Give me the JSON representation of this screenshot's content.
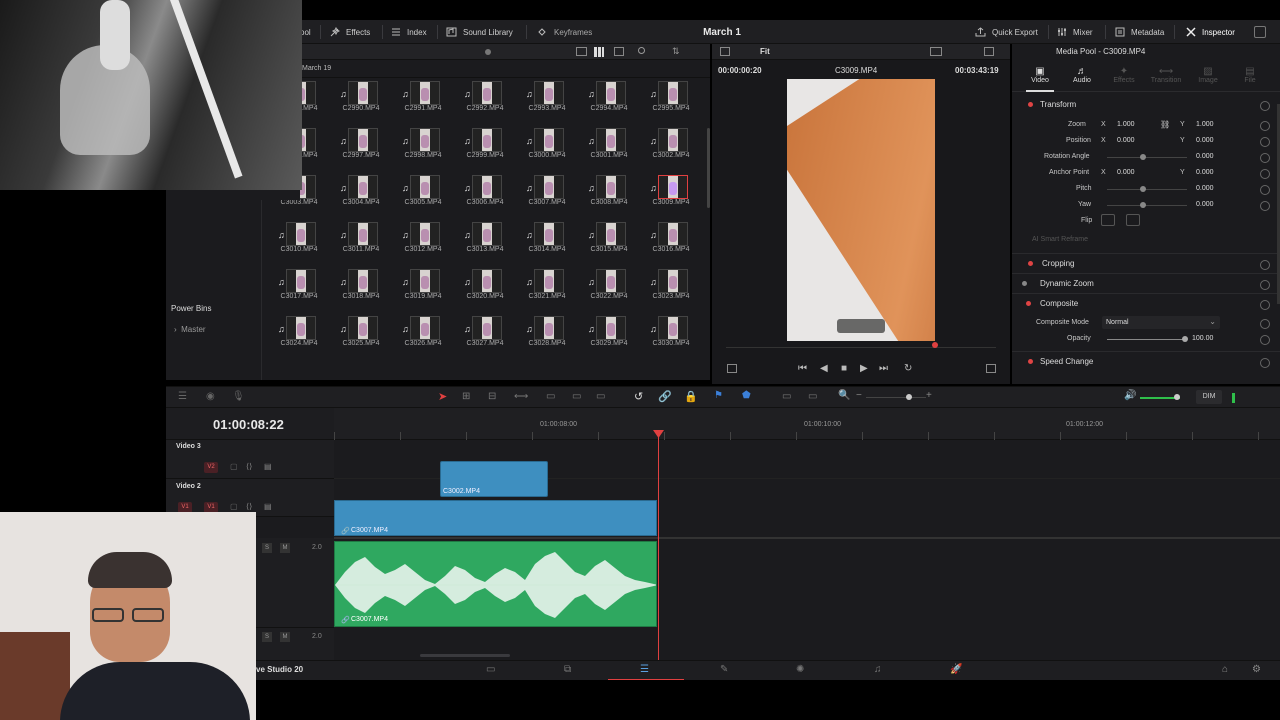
{
  "topbar": {
    "media_pool_partial": "ool",
    "effects": "Effects",
    "index": "Index",
    "sound_library": "Sound Library",
    "keyframes": "Keyframes",
    "title": "March 1",
    "quick_export": "Quick Export",
    "mixer": "Mixer",
    "metadata": "Metadata",
    "inspector": "Inspector"
  },
  "media_pool": {
    "folder": "March 19",
    "fit": "Fit",
    "power_bins": "Power Bins",
    "master": "Master",
    "rows": [
      [
        "C2989.MP4",
        "C2990.MP4",
        "C2991.MP4",
        "C2992.MP4",
        "C2993.MP4",
        "C2994.MP4",
        "C2995.MP4"
      ],
      [
        "C2996.MP4",
        "C2997.MP4",
        "C2998.MP4",
        "C2999.MP4",
        "C3000.MP4",
        "C3001.MP4",
        "C3002.MP4"
      ],
      [
        "C3003.MP4",
        "C3004.MP4",
        "C3005.MP4",
        "C3006.MP4",
        "C3007.MP4",
        "C3008.MP4",
        "C3009.MP4"
      ],
      [
        "C3010.MP4",
        "C3011.MP4",
        "C3012.MP4",
        "C3013.MP4",
        "C3014.MP4",
        "C3015.MP4",
        "C3016.MP4"
      ],
      [
        "C3017.MP4",
        "C3018.MP4",
        "C3019.MP4",
        "C3020.MP4",
        "C3021.MP4",
        "C3022.MP4",
        "C3023.MP4"
      ],
      [
        "C3024.MP4",
        "C3025.MP4",
        "C3026.MP4",
        "C3027.MP4",
        "C3028.MP4",
        "C3029.MP4",
        "C3030.MP4"
      ]
    ],
    "selected": "C3009.MP4"
  },
  "viewer": {
    "timecode_left": "00:00:00:20",
    "clip_name": "C3009.MP4",
    "timecode_right": "00:03:43:19"
  },
  "inspector": {
    "title": "Media Pool - C3009.MP4",
    "tabs": [
      "Video",
      "Audio",
      "Effects",
      "Transition",
      "Image",
      "File"
    ],
    "transform": "Transform",
    "zoom_label": "Zoom",
    "zoom_x": "1.000",
    "zoom_y": "1.000",
    "position_label": "Position",
    "position_x": "0.000",
    "position_y": "0.000",
    "rotation_label": "Rotation Angle",
    "rotation": "0.000",
    "anchor_label": "Anchor Point",
    "anchor_x": "0.000",
    "anchor_y": "0.000",
    "pitch_label": "Pitch",
    "pitch": "0.000",
    "yaw_label": "Yaw",
    "yaw": "0.000",
    "flip_label": "Flip",
    "smart_reframe": "AI Smart Reframe",
    "cropping": "Cropping",
    "dynamic_zoom": "Dynamic Zoom",
    "composite": "Composite",
    "composite_mode_label": "Composite Mode",
    "composite_mode": "Normal",
    "opacity_label": "Opacity",
    "opacity": "100.00",
    "speed_change": "Speed Change",
    "x": "X",
    "y": "Y"
  },
  "timeline": {
    "timecode": "01:00:08:22",
    "ruler": [
      "01:00:08:00",
      "01:00:10:00",
      "01:00:12:00"
    ],
    "video3": "Video 3",
    "video2": "Video 2",
    "v2": "V2",
    "v1a": "V1",
    "v1b": "V1",
    "clip_v2": "C3002.MP4",
    "clip_v1": "C3007.MP4",
    "clip_a1": "C3007.MP4",
    "vol1": "2.0",
    "vol2": "2.0",
    "s": "S",
    "m": "M",
    "dim": "DIM"
  },
  "bottom": {
    "app_partial": "ve Studio 20"
  }
}
